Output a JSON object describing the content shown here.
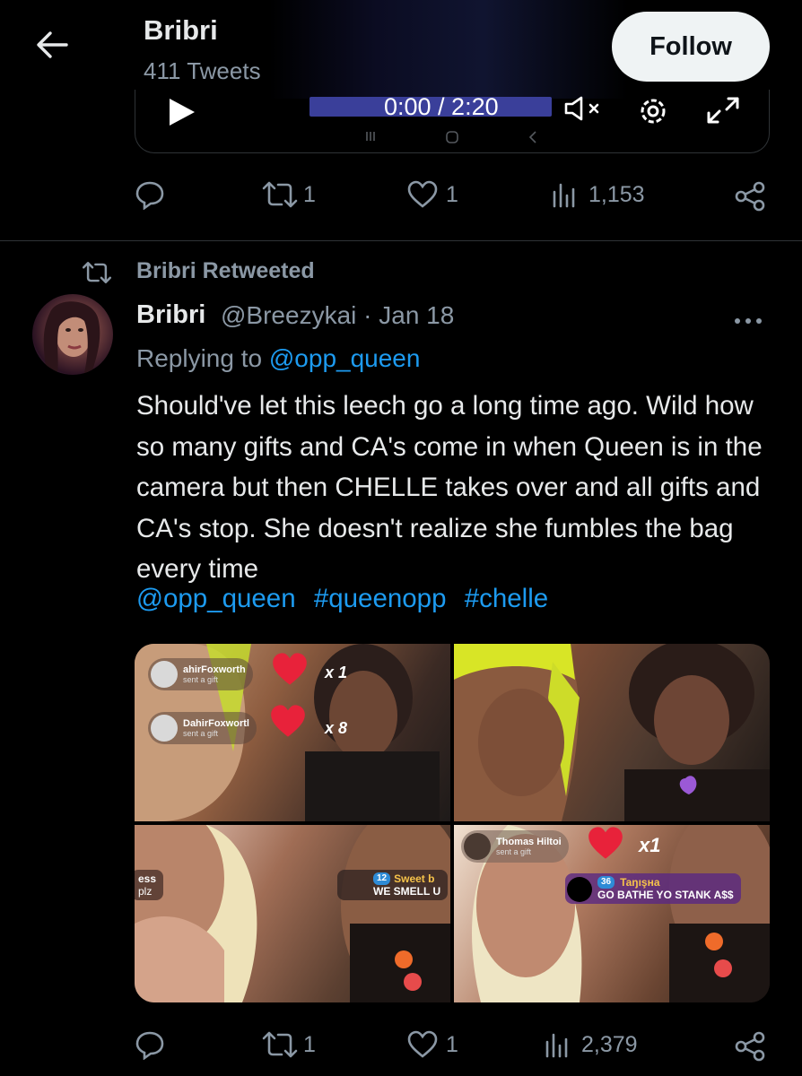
{
  "header": {
    "title": "Bribri",
    "subtitle": "411 Tweets",
    "follow_label": "Follow"
  },
  "video": {
    "time": "0:00 / 2:20"
  },
  "prev_tweet": {
    "retweets": "1",
    "likes": "1",
    "views": "1,153"
  },
  "tweet": {
    "retweeted_label": "Bribri Retweeted",
    "author_name": "Bribri",
    "handle_date": "@Breezykai · Jan 18",
    "replying_prefix": "Replying to",
    "replying_to": "@opp_queen",
    "text": "Should've let this leech go a long time ago. Wild how so many gifts and CA's come in when Queen is in the camera but then CHELLE takes over and all gifts and CA's stop. She doesn't realize she fumbles the bag every time",
    "mention": "@opp_queen",
    "hashtags": [
      "#queenopp",
      "#chelle"
    ],
    "retweets": "1",
    "likes": "1",
    "views": "2,379"
  },
  "media": {
    "tile1": {
      "gift1_name": "ahirFoxworth",
      "gift1_sub": "sent a gift",
      "gift1_mult": "x 1",
      "gift2_name": "DahirFoxwortl",
      "gift2_sub": "sent a gift",
      "gift2_mult": "x 8"
    },
    "tile3": {
      "left_chat_name": "ess",
      "left_chat_text": "plz",
      "right_chat_badge": "12",
      "right_chat_name": "Sweet b",
      "right_chat_text": "WE SMELL U"
    },
    "tile4": {
      "gift_name": "Thomas Hiltoi",
      "gift_sub": "sent a gift",
      "gift_mult": "x1",
      "chat_badge": "36",
      "chat_name": "Taŋışнa",
      "chat_text": "GO BATHE YO STANK A$$"
    }
  },
  "colors": {
    "accent": "#1d9bf0",
    "muted": "#8b98a5",
    "background": "#000000"
  },
  "icons": [
    "back-arrow-icon",
    "play-icon",
    "mute-icon",
    "settings-icon",
    "fullscreen-icon",
    "reply-icon",
    "retweet-icon",
    "like-icon",
    "views-icon",
    "share-icon",
    "more-icon"
  ]
}
